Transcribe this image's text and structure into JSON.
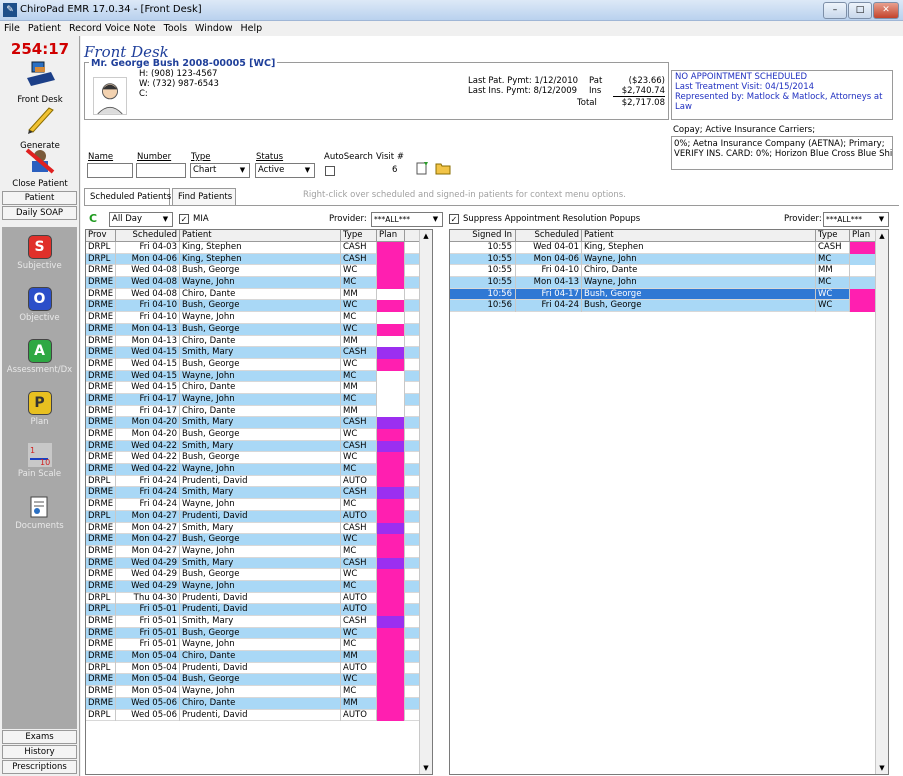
{
  "window": {
    "title": "ChiroPad EMR  17.0.34 - [Front Desk]",
    "min": "–",
    "max": "□",
    "close": "✕"
  },
  "menu": [
    "File",
    "Patient",
    "Record Voice Note",
    "Tools",
    "Window",
    "Help"
  ],
  "sidebar": {
    "clock": "254:17",
    "front_desk": "Front Desk",
    "generate": "Generate",
    "close_patient": "Close Patient",
    "patient_btn": "Patient",
    "daily_soap_btn": "Daily SOAP",
    "soap": [
      {
        "letter": "S",
        "label": "Subjective",
        "color": "#e0302a"
      },
      {
        "letter": "O",
        "label": "Objective",
        "color": "#2b4fc9"
      },
      {
        "letter": "A",
        "label": "Assessment/Dx",
        "color": "#2ea843"
      },
      {
        "letter": "P",
        "label": "Plan",
        "color": "#e8c020"
      }
    ],
    "pain_scale": "Pain Scale",
    "documents": "Documents",
    "exams": "Exams",
    "history": "History",
    "prescriptions": "Prescriptions"
  },
  "page": {
    "title": "Front Desk"
  },
  "patient": {
    "name": "Mr. George Bush 2008-00005 [WC]",
    "home": "H: (908) 123-4567",
    "work": "W: (732) 987-6543",
    "cell": "C:",
    "last_pat_pymt": "Last Pat. Pymt: 1/12/2010",
    "last_ins_pymt": "Last Ins. Pymt: 8/12/2009",
    "pat_label": "Pat",
    "pat_val": "($23.66)",
    "ins_label": "Ins",
    "ins_val": "$2,740.74",
    "total_label": "Total",
    "total_val": "$2,717.08"
  },
  "appointment": {
    "line1": "NO APPOINTMENT SCHEDULED",
    "line2": "Last Treatment Visit:  04/15/2014",
    "line3": "Represented by: Matlock & Matlock, Attorneys at Law"
  },
  "copay": {
    "label": "Copay; Active Insurance Carriers;",
    "line1": "0%; Aetna Insurance Company (AETNA); Primary;",
    "line2": "VERIFY INS. CARD: 0%; Horizon Blue Cross Blue Shie"
  },
  "filters": {
    "name_label": "Name",
    "number_label": "Number",
    "type_label": "Type",
    "status_label": "Status",
    "autosearch_label": "AutoSearch",
    "visit_label": "Visit #",
    "type_value": "Chart",
    "status_value": "Active",
    "visit_value": "6"
  },
  "tabs": {
    "scheduled": "Scheduled Patients",
    "find": "Find Patients"
  },
  "hint": "Right-click over scheduled and signed-in patients for context menu options.",
  "left_toolbar": {
    "refresh": "C",
    "range": "All Day",
    "mia_label": "MIA",
    "provider_label": "Provider:",
    "provider_value": "***ALL***"
  },
  "right_toolbar": {
    "suppress_label": "Suppress Appointment Resolution Popups",
    "provider_label": "Provider:",
    "provider_value": "***ALL***"
  },
  "left_table": {
    "headers": [
      "Prov",
      "Scheduled",
      "Patient",
      "Type",
      "Plan"
    ],
    "rows": [
      [
        "DRPL",
        "Fri 04-03",
        "King, Stephen",
        "CASH",
        "#ff1fb0",
        0
      ],
      [
        "DRPL",
        "Mon 04-06",
        "King, Stephen",
        "CASH",
        "#ff1fb0",
        1
      ],
      [
        "DRME",
        "Wed 04-08",
        "Bush, George",
        "WC",
        "#ff1fb0",
        0
      ],
      [
        "DRME",
        "Wed 04-08",
        "Wayne, John",
        "MC",
        "#ff1fb0",
        1
      ],
      [
        "DRME",
        "Wed 04-08",
        "Chiro, Dante",
        "MM",
        "",
        0
      ],
      [
        "DRME",
        "Fri 04-10",
        "Bush, George",
        "WC",
        "#ff1fb0",
        1
      ],
      [
        "DRME",
        "Fri 04-10",
        "Wayne, John",
        "MC",
        "",
        0
      ],
      [
        "DRME",
        "Mon 04-13",
        "Bush, George",
        "WC",
        "#ff1fb0",
        1
      ],
      [
        "DRME",
        "Mon 04-13",
        "Chiro, Dante",
        "MM",
        "",
        0
      ],
      [
        "DRME",
        "Wed 04-15",
        "Smith, Mary",
        "CASH",
        "#9b2ff0",
        1
      ],
      [
        "DRME",
        "Wed 04-15",
        "Bush, George",
        "WC",
        "#ff1fb0",
        0
      ],
      [
        "DRME",
        "Wed 04-15",
        "Wayne, John",
        "MC",
        "",
        1
      ],
      [
        "DRME",
        "Wed 04-15",
        "Chiro, Dante",
        "MM",
        "",
        0
      ],
      [
        "DRME",
        "Fri 04-17",
        "Wayne, John",
        "MC",
        "",
        1
      ],
      [
        "DRME",
        "Fri 04-17",
        "Chiro, Dante",
        "MM",
        "",
        0
      ],
      [
        "DRME",
        "Mon 04-20",
        "Smith, Mary",
        "CASH",
        "#9b2ff0",
        1
      ],
      [
        "DRME",
        "Mon 04-20",
        "Bush, George",
        "WC",
        "#ff1fb0",
        0
      ],
      [
        "DRME",
        "Wed 04-22",
        "Smith, Mary",
        "CASH",
        "#9b2ff0",
        1
      ],
      [
        "DRME",
        "Wed 04-22",
        "Bush, George",
        "WC",
        "#ff1fb0",
        0
      ],
      [
        "DRME",
        "Wed 04-22",
        "Wayne, John",
        "MC",
        "#ff1fb0",
        1
      ],
      [
        "DRPL",
        "Fri 04-24",
        "Prudenti, David",
        "AUTO",
        "#ff1fb0",
        0
      ],
      [
        "DRME",
        "Fri 04-24",
        "Smith, Mary",
        "CASH",
        "#9b2ff0",
        1
      ],
      [
        "DRME",
        "Fri 04-24",
        "Wayne, John",
        "MC",
        "#ff1fb0",
        0
      ],
      [
        "DRPL",
        "Mon 04-27",
        "Prudenti, David",
        "AUTO",
        "#ff1fb0",
        1
      ],
      [
        "DRME",
        "Mon 04-27",
        "Smith, Mary",
        "CASH",
        "#9b2ff0",
        0
      ],
      [
        "DRME",
        "Mon 04-27",
        "Bush, George",
        "WC",
        "#ff1fb0",
        1
      ],
      [
        "DRME",
        "Mon 04-27",
        "Wayne, John",
        "MC",
        "#ff1fb0",
        0
      ],
      [
        "DRME",
        "Wed 04-29",
        "Smith, Mary",
        "CASH",
        "#9b2ff0",
        1
      ],
      [
        "DRME",
        "Wed 04-29",
        "Bush, George",
        "WC",
        "#ff1fb0",
        0
      ],
      [
        "DRME",
        "Wed 04-29",
        "Wayne, John",
        "MC",
        "#ff1fb0",
        1
      ],
      [
        "DRPL",
        "Thu 04-30",
        "Prudenti, David",
        "AUTO",
        "#ff1fb0",
        0
      ],
      [
        "DRPL",
        "Fri 05-01",
        "Prudenti, David",
        "AUTO",
        "#ff1fb0",
        1
      ],
      [
        "DRME",
        "Fri 05-01",
        "Smith, Mary",
        "CASH",
        "#9b2ff0",
        0
      ],
      [
        "DRME",
        "Fri 05-01",
        "Bush, George",
        "WC",
        "#ff1fb0",
        1
      ],
      [
        "DRME",
        "Fri 05-01",
        "Wayne, John",
        "MC",
        "#ff1fb0",
        0
      ],
      [
        "DRME",
        "Mon 05-04",
        "Chiro, Dante",
        "MM",
        "#ff1fb0",
        1
      ],
      [
        "DRPL",
        "Mon 05-04",
        "Prudenti, David",
        "AUTO",
        "#ff1fb0",
        0
      ],
      [
        "DRME",
        "Mon 05-04",
        "Bush, George",
        "WC",
        "#ff1fb0",
        1
      ],
      [
        "DRME",
        "Mon 05-04",
        "Wayne, John",
        "MC",
        "#ff1fb0",
        0
      ],
      [
        "DRME",
        "Wed 05-06",
        "Chiro, Dante",
        "MM",
        "#ff1fb0",
        1
      ],
      [
        "DRPL",
        "Wed 05-06",
        "Prudenti, David",
        "AUTO",
        "#ff1fb0",
        0
      ]
    ]
  },
  "right_table": {
    "headers": [
      "Signed In",
      "Scheduled",
      "Patient",
      "Type",
      "Plan"
    ],
    "rows": [
      [
        "10:55",
        "Wed 04-01",
        "King, Stephen",
        "CASH",
        "#ff1fb0",
        "w"
      ],
      [
        "10:55",
        "Mon 04-06",
        "Wayne, John",
        "MC",
        "#a9d8f6",
        "b"
      ],
      [
        "10:55",
        "Fri 04-10",
        "Chiro, Dante",
        "MM",
        "",
        "w"
      ],
      [
        "10:55",
        "Mon 04-13",
        "Wayne, John",
        "MC",
        "#a9d8f6",
        "b"
      ],
      [
        "10:56",
        "Fri 04-17",
        "Bush, George",
        "WC",
        "#ff1fb0",
        "s"
      ],
      [
        "10:56",
        "Fri 04-24",
        "Bush, George",
        "WC",
        "#ff1fb0",
        "b"
      ]
    ]
  }
}
